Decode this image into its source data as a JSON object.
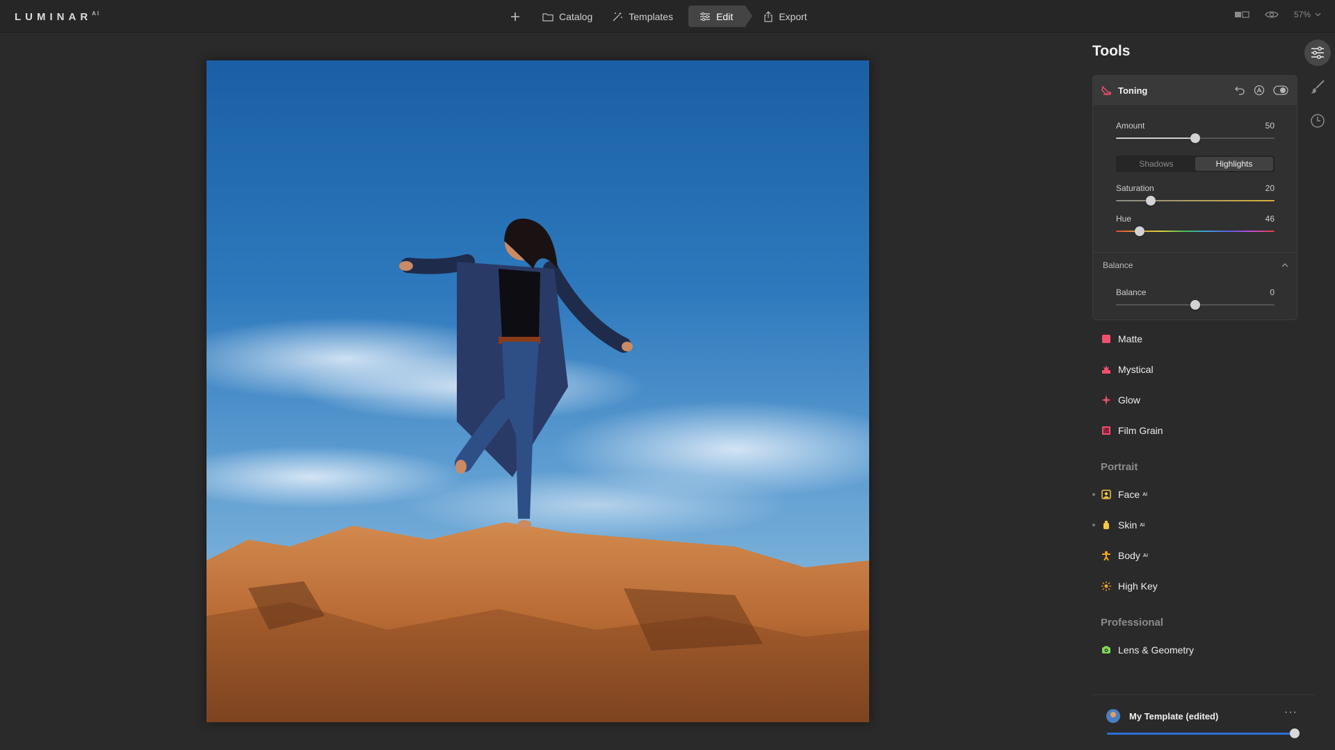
{
  "app": {
    "logo": "LUMINAR",
    "logo_sup": "AI",
    "zoom": "57%"
  },
  "nav": {
    "catalog": "Catalog",
    "templates": "Templates",
    "edit": "Edit",
    "export": "Export"
  },
  "tools": {
    "title": "Tools",
    "toning": {
      "title": "Toning",
      "amount": {
        "label": "Amount",
        "value": "50",
        "fraction": 0.5
      },
      "tabs": [
        "Shadows",
        "Highlights"
      ],
      "active_tab": "Highlights",
      "saturation": {
        "label": "Saturation",
        "value": "20",
        "fraction": 0.22
      },
      "hue": {
        "label": "Hue",
        "value": "46",
        "fraction": 0.15
      },
      "balance_section": "Balance",
      "balance": {
        "label": "Balance",
        "value": "0",
        "fraction": 0.5
      }
    },
    "creative_items": [
      {
        "label": "Matte",
        "icon": "matte-icon",
        "color": "#f0506e"
      },
      {
        "label": "Mystical",
        "icon": "mystical-icon",
        "color": "#f0506e"
      },
      {
        "label": "Glow",
        "icon": "glow-icon",
        "color": "#f0506e"
      },
      {
        "label": "Film Grain",
        "icon": "film-grain-icon",
        "color": "#f0506e"
      }
    ],
    "portrait_section": "Portrait",
    "portrait_items": [
      {
        "label": "Face",
        "badge": "AI",
        "icon": "face-icon",
        "color": "#f5c842"
      },
      {
        "label": "Skin",
        "badge": "AI",
        "icon": "skin-icon",
        "color": "#f5c842"
      },
      {
        "label": "Body",
        "badge": "AI",
        "icon": "body-icon",
        "color": "#f5a623"
      },
      {
        "label": "High Key",
        "badge": "",
        "icon": "high-key-icon",
        "color": "#f5a623"
      }
    ],
    "professional_section": "Professional",
    "professional_items": [
      {
        "label": "Lens & Geometry",
        "icon": "lens-geometry-icon",
        "color": "#7ed957"
      }
    ]
  },
  "template": {
    "name": "My Template (edited)",
    "amount_fraction": 1.0,
    "more": "···"
  },
  "colors": {
    "accent": "#2d6fd6",
    "toning": "#f0506e"
  }
}
